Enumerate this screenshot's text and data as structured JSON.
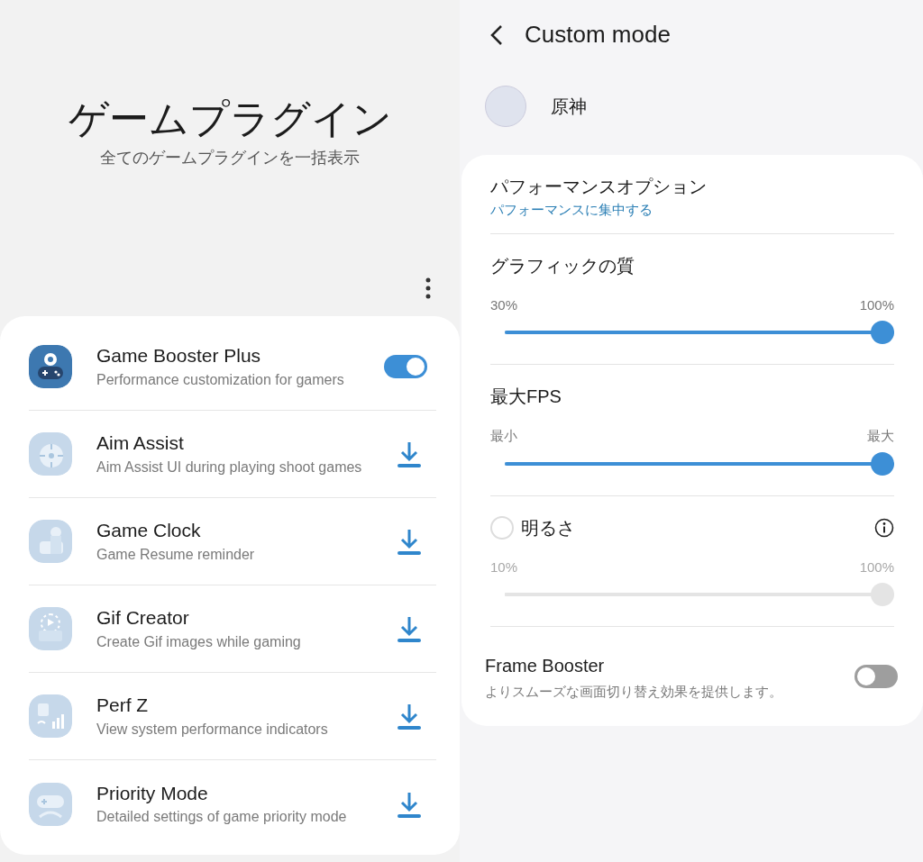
{
  "plugins_page": {
    "title": "ゲームプラグイン",
    "subtitle": "全てのゲームプラグインを一括表示",
    "plugins": [
      {
        "kind": "installed",
        "name": "Game Booster Plus",
        "description": "Performance customization for gamers",
        "on": true
      },
      {
        "kind": "download",
        "name": "Aim Assist",
        "description": "Aim Assist UI during playing shoot games"
      },
      {
        "kind": "download",
        "name": "Game Clock",
        "description": "Game Resume reminder"
      },
      {
        "kind": "download",
        "name": "Gif Creator",
        "description": "Create Gif images while gaming"
      },
      {
        "kind": "download",
        "name": "Perf Z",
        "description": "View system performance indicators"
      },
      {
        "kind": "download",
        "name": "Priority Mode",
        "description": "Detailed settings of game priority mode"
      }
    ]
  },
  "custom_mode": {
    "title": "Custom mode",
    "game": "原神",
    "performance": {
      "label": "パフォーマンスオプション",
      "value": "パフォーマンスに集中する"
    },
    "sliders": [
      {
        "kind": "plain",
        "label": "グラフィックの質",
        "min_label": "30%",
        "max_label": "100%",
        "level": 1,
        "disabled": false
      },
      {
        "kind": "plain",
        "label": "最大FPS",
        "min_label": "最小",
        "max_label": "最大",
        "level": 1,
        "disabled": false
      },
      {
        "kind": "checkbox",
        "label": "明るさ",
        "min_label": "10%",
        "max_label": "100%",
        "level": 1,
        "disabled": true,
        "checked": false
      }
    ],
    "frame_booster": {
      "label": "Frame Booster",
      "description": "よりスムーズな画面切り替え効果を提供します。",
      "on": false
    }
  }
}
